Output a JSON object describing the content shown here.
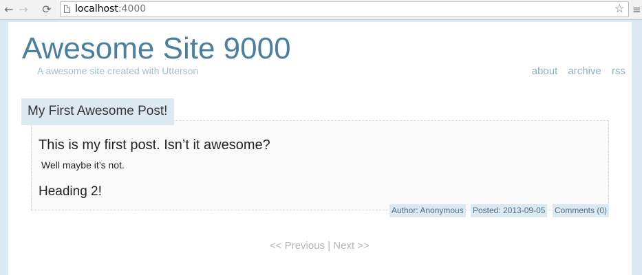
{
  "browser": {
    "back_icon": "←",
    "forward_icon": "→",
    "reload_icon": "⟳",
    "url_host": "localhost",
    "url_port": ":4000",
    "star_icon": "☆",
    "menu_icon": "≡"
  },
  "site": {
    "title": "Awesome Site 9000",
    "subtitle": "A awesome site created with Utterson",
    "nav": [
      "about",
      "archive",
      "rss"
    ]
  },
  "post": {
    "title": "My First Awesome Post!",
    "heading1": "This is my first post. Isn’t it awesome?",
    "paragraph": "Well maybe it’s not.",
    "heading2": "Heading 2!",
    "author": "Author: Anonymous",
    "posted": "Posted: 2013-09-05",
    "comments": "Comments (0)"
  },
  "pager": {
    "previous": "<< Previous",
    "separator": " | ",
    "next": "Next >>"
  },
  "colors": {
    "accent": "#4a7f9f",
    "subtitle": "#9fbfd2",
    "tag_background": "#dde9f1",
    "page_background": "#dbe9f3"
  }
}
